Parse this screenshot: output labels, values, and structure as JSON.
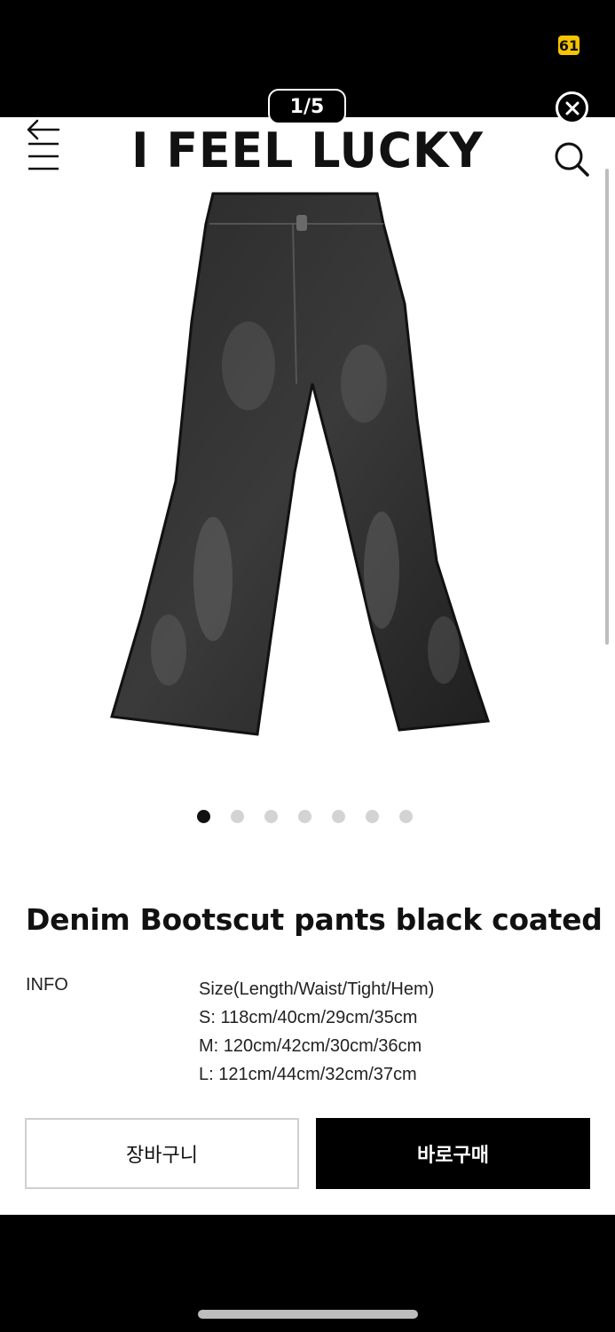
{
  "status_bar": {
    "battery": "61"
  },
  "viewer": {
    "page_counter": "1/5"
  },
  "header": {
    "logo": "I FEEL LUCKY"
  },
  "carousel": {
    "dot_count": 7,
    "active_index": 0
  },
  "product": {
    "title": "Denim Bootscut pants black coated",
    "info_label": "INFO",
    "info_lines": [
      "Size(Length/Waist/Tight/Hem)",
      "S: 118cm/40cm/29cm/35cm",
      "M: 120cm/42cm/30cm/36cm",
      "L: 121cm/44cm/32cm/37cm"
    ]
  },
  "actions": {
    "cart_label": "장바구니",
    "buy_label": "바로구매"
  }
}
